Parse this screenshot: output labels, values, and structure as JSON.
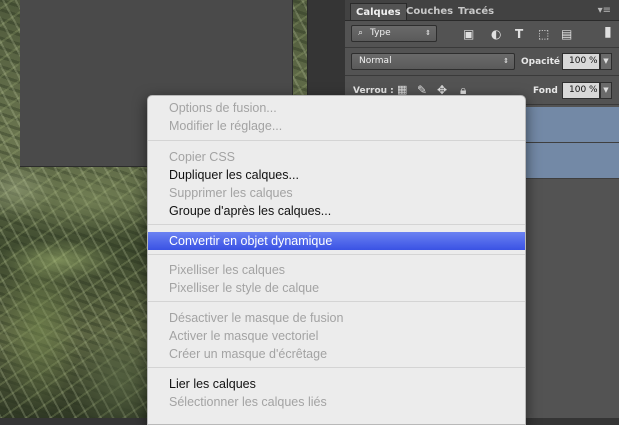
{
  "panel": {
    "tabs": [
      "Calques",
      "Couches",
      "Tracés"
    ],
    "menu_icon": "panel-menu-icon",
    "filter": {
      "label": "Type",
      "icon": "search-icon"
    },
    "blend_mode": "Normal",
    "opacity_label": "Opacité :",
    "opacity_value": "100 %",
    "lock_label": "Verrou :",
    "fill_label": "Fond :",
    "fill_value": "100 %"
  },
  "context_menu": {
    "groups": [
      [
        {
          "label": "Options de fusion...",
          "enabled": false
        },
        {
          "label": "Modifier le réglage...",
          "enabled": false
        }
      ],
      [
        {
          "label": "Copier CSS",
          "enabled": false
        },
        {
          "label": "Dupliquer les calques...",
          "enabled": true
        },
        {
          "label": "Supprimer les calques",
          "enabled": false
        },
        {
          "label": "Groupe d'après les calques...",
          "enabled": true
        }
      ],
      [
        {
          "label": "Convertir en objet dynamique",
          "enabled": true,
          "highlighted": true
        }
      ],
      [
        {
          "label": "Pixelliser les calques",
          "enabled": false
        },
        {
          "label": "Pixelliser le style de calque",
          "enabled": false
        }
      ],
      [
        {
          "label": "Désactiver le masque de fusion",
          "enabled": false
        },
        {
          "label": "Activer le masque vectoriel",
          "enabled": false
        },
        {
          "label": "Créer un masque d'écrêtage",
          "enabled": false
        }
      ],
      [
        {
          "label": "Lier les calques",
          "enabled": true
        },
        {
          "label": "Sélectionner les calques liés",
          "enabled": false
        }
      ]
    ]
  },
  "colors": {
    "highlight": "#3a52e4",
    "selected_layer": "#7389a6",
    "panel_bg": "#535353"
  }
}
